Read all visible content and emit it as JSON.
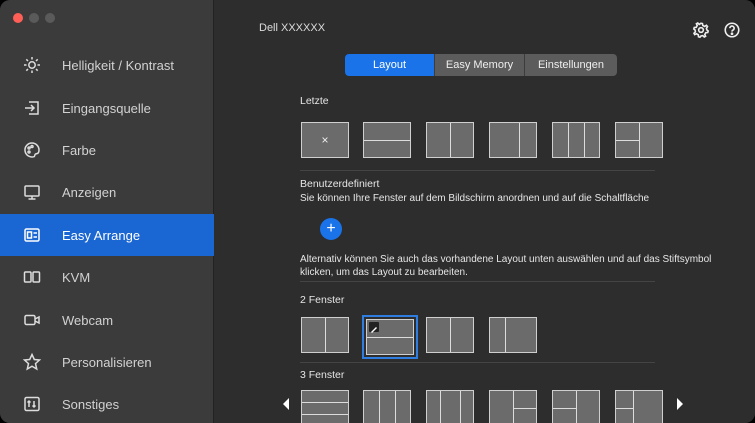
{
  "window": {
    "title": "Dell XXXXXX"
  },
  "sidebar": {
    "items": [
      {
        "label": "Helligkeit / Kontrast",
        "icon": "brightness-icon"
      },
      {
        "label": "Eingangsquelle",
        "icon": "input-source-icon"
      },
      {
        "label": "Farbe",
        "icon": "color-palette-icon"
      },
      {
        "label": "Anzeigen",
        "icon": "display-icon"
      },
      {
        "label": "Easy Arrange",
        "icon": "easy-arrange-icon"
      },
      {
        "label": "KVM",
        "icon": "kvm-icon"
      },
      {
        "label": "Webcam",
        "icon": "webcam-icon"
      },
      {
        "label": "Personalisieren",
        "icon": "star-icon"
      },
      {
        "label": "Sonstiges",
        "icon": "misc-icon"
      }
    ],
    "active_index": 4
  },
  "tabs": [
    "Layout",
    "Easy Memory",
    "Einstellungen"
  ],
  "active_tab": "Layout",
  "recent": {
    "heading": "Letzte",
    "empty_mark": "×"
  },
  "custom": {
    "heading": "Benutzerdefiniert",
    "description": "Sie können Ihre Fenster auf dem Bildschirm anordnen und auf die Schaltfläche",
    "add_label": "+",
    "alt_text": "Alternativ können Sie auch das vorhandene Layout unten auswählen und auf das Stiftsymbol klicken, um das Layout zu bearbeiten."
  },
  "two_windows": {
    "heading": "2 Fenster"
  },
  "three_windows": {
    "heading": "3 Fenster"
  },
  "colors": {
    "accent": "#1a73e8",
    "sidebar_bg": "#3b3b3b",
    "main_bg": "#2d2d2d",
    "thumb_fill": "#6b6b6b"
  }
}
